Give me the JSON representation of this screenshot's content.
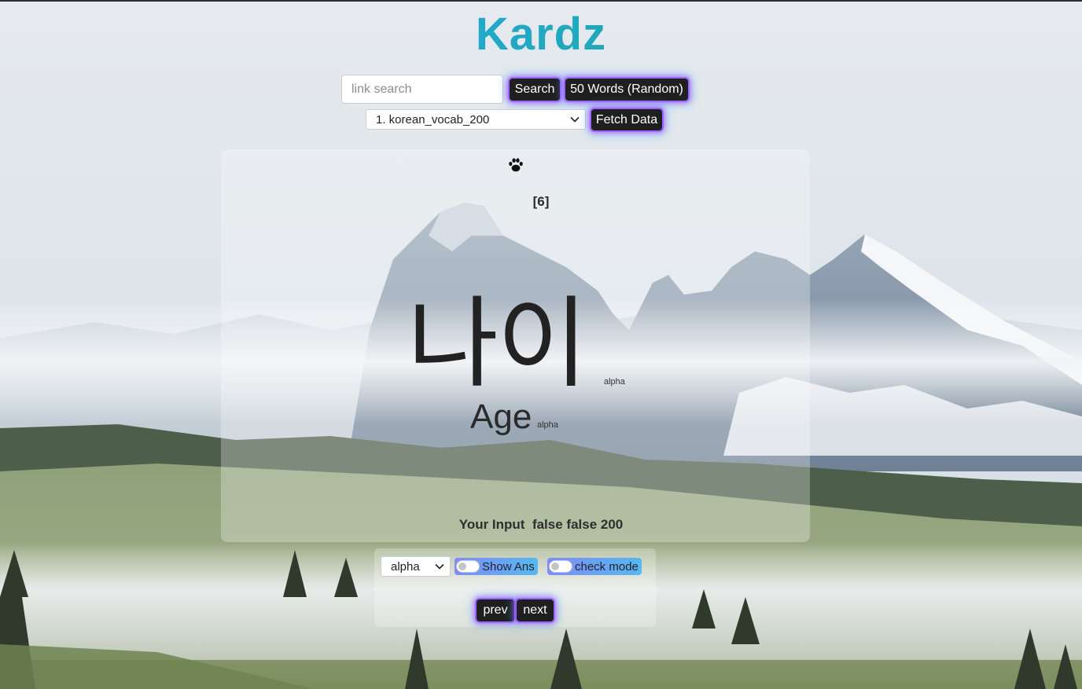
{
  "app": {
    "title": "Kardz",
    "brand_gradient": [
      "#2fb5e0",
      "#17a07a"
    ]
  },
  "search": {
    "placeholder": "link search",
    "value": "",
    "search_label": "Search",
    "random_label": "50 Words (Random)"
  },
  "dataset": {
    "selected": "1. korean_vocab_200",
    "fetch_label": "Fetch Data"
  },
  "card": {
    "icon": "paw-icon",
    "index_label": "[6]",
    "word": "나이",
    "word_tag": "alpha",
    "meaning": "Age",
    "meaning_tag": "alpha",
    "your_input_label": "Your Input",
    "your_input_values": "false false 200"
  },
  "controls": {
    "mode_selected": "alpha",
    "show_ans_label": "Show Ans",
    "show_ans_on": false,
    "check_mode_label": "check mode",
    "check_mode_on": false,
    "prev_label": "prev",
    "next_label": "next"
  },
  "colors": {
    "button_bg": "#1f1f1f",
    "button_glow": "#c846ff",
    "toggle_gradient": [
      "#7f8cf5",
      "#57b8ee"
    ]
  }
}
